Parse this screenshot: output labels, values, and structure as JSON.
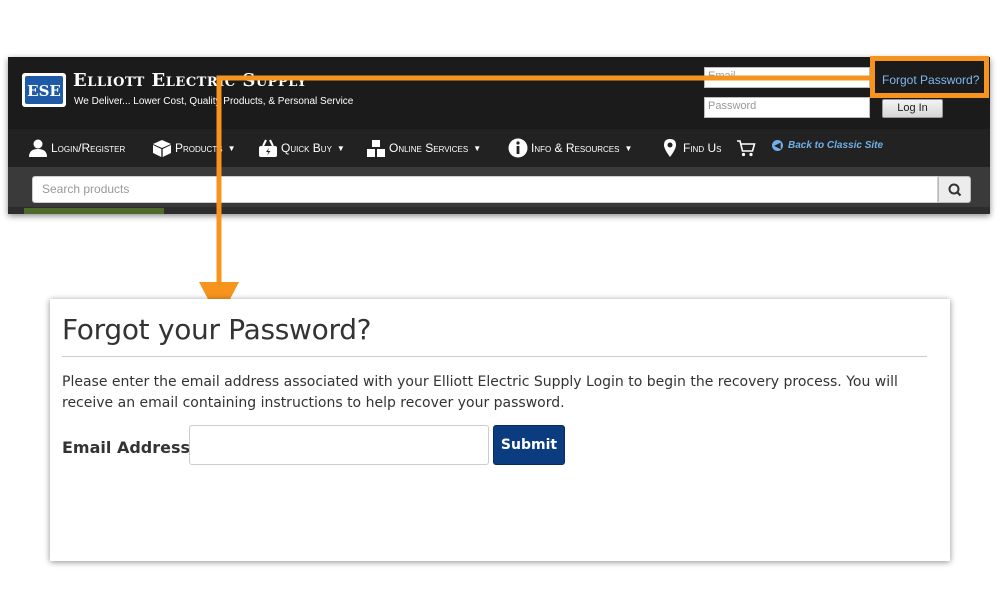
{
  "header": {
    "brand_name": "Elliott Electric Supply",
    "tagline": "We Deliver... Lower Cost, Quality Products, & Personal Service",
    "logo_text": "ESE",
    "email_placeholder": "Email",
    "password_placeholder": "Password",
    "login_label": "Log In",
    "forgot_password_link": "Forgot Password?"
  },
  "nav": {
    "items": [
      {
        "label": "Login/Register",
        "icon": "user-icon",
        "caret": false
      },
      {
        "label": "Products",
        "icon": "box-icon",
        "caret": true
      },
      {
        "label": "Quick Buy",
        "icon": "basket-icon",
        "caret": true
      },
      {
        "label": "Online Services",
        "icon": "blocks-icon",
        "caret": true
      },
      {
        "label": "Info & Resources",
        "icon": "info-icon",
        "caret": true
      },
      {
        "label": "Find Us",
        "icon": "map-pin-icon",
        "caret": false
      }
    ],
    "cart_icon": "cart-icon",
    "classic_site_link": "Back to Classic Site"
  },
  "search": {
    "placeholder": "Search products",
    "button_icon": "search-icon"
  },
  "annotation": {
    "highlight_color": "#f7941d"
  },
  "forgot_panel": {
    "title": "Forgot your Password?",
    "instructions": "Please enter the email address associated with your Elliott Electric Supply Login to begin the recovery process. You will receive an email containing instructions to help recover your password.",
    "email_label": "Email Address:",
    "email_value": "",
    "submit_label": "Submit",
    "submit_color": "#0b3c80"
  }
}
